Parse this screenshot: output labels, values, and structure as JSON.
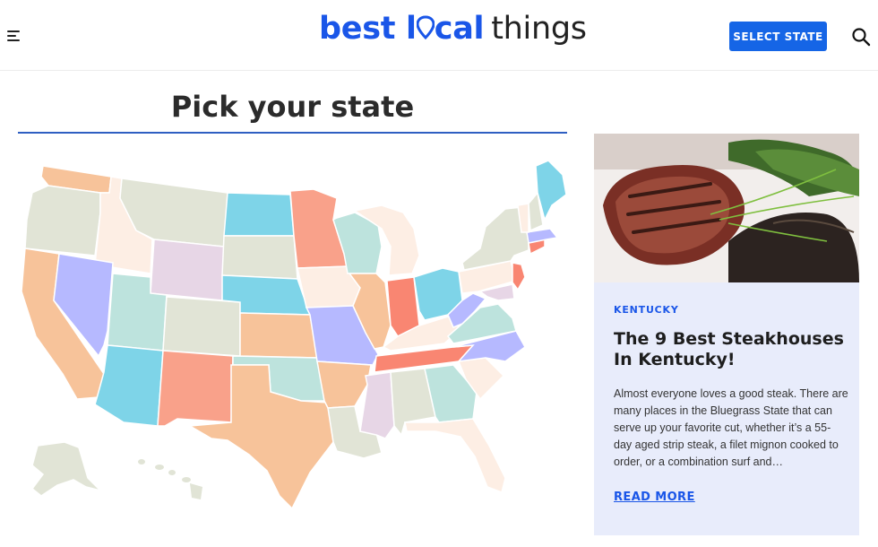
{
  "header": {
    "logo_part1": "best l",
    "logo_part2": "cal",
    "logo_part3": "things",
    "select_state_label": "SELECT STATE",
    "menu_icon": "hamburger-menu-icon",
    "search_icon": "search-icon",
    "brand_color": "#1a56e8"
  },
  "main": {
    "title": "Pick your state"
  },
  "map": {
    "map_icon": "us-states-map"
  },
  "card": {
    "category": "KENTUCKY",
    "title": "The 9 Best Steakhouses In Kentucky!",
    "excerpt": "Almost everyone loves a good steak. There are many places in the Bluegrass State that can serve up your favorite cut, whether it’s a 55-day aged strip steak, a filet mignon cooked to order, or a combination surf and…",
    "read_more": "READ MORE",
    "image_subject": "grilled-steak-photo"
  }
}
